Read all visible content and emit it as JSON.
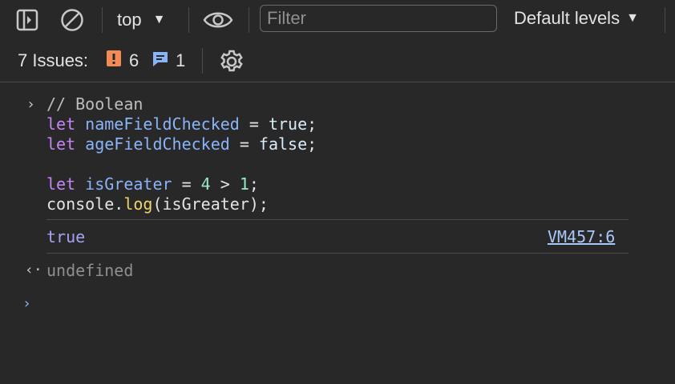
{
  "toolbar": {
    "context_label": "top",
    "filter_placeholder": "Filter",
    "levels_label": "Default levels"
  },
  "issues": {
    "label": "7 Issues:",
    "error_count": "6",
    "info_count": "1"
  },
  "console": {
    "input": {
      "comment": "// Boolean",
      "lines": [
        {
          "kw": "let",
          "name": "nameFieldChecked",
          "op": " = ",
          "value": "true",
          "end": ";"
        },
        {
          "kw": "let",
          "name": "ageFieldChecked",
          "op": " = ",
          "value": "false",
          "end": ";"
        },
        {
          "kw": "let",
          "name": "isGreater",
          "op": " = ",
          "a": "4",
          "cmp": " > ",
          "b": "1",
          "end": ";"
        }
      ],
      "log": {
        "obj": "console.",
        "fn": "log",
        "args": "(isGreater);"
      }
    },
    "output": {
      "value": "true",
      "source": "VM457:6"
    },
    "return_value": "undefined"
  },
  "colors": {
    "background": "#282828",
    "keyword": "#c586f5",
    "variable": "#8ab4f8",
    "link": "#a8c7fa",
    "error_badge": "#f28b54",
    "info_badge": "#8ab4f8"
  }
}
